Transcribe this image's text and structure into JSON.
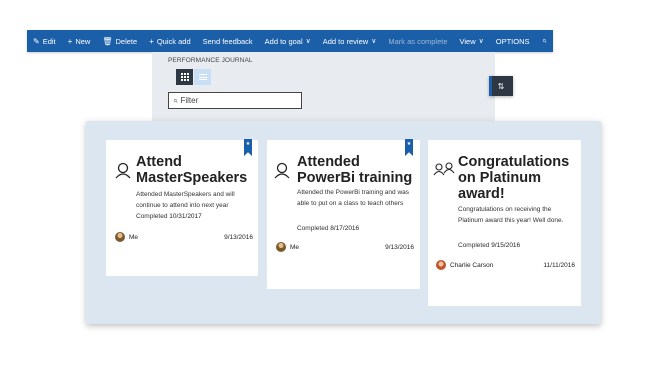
{
  "command_bar": {
    "edit": "Edit",
    "new": "New",
    "delete": "Delete",
    "quick_add": "Quick add",
    "send_feedback": "Send feedback",
    "add_to_goal": "Add to goal",
    "add_to_review": "Add to review",
    "mark_as_complete": "Mark as complete",
    "view": "View",
    "options": "OPTIONS"
  },
  "breadcrumb": "PERFORMANCE JOURNAL",
  "filter": {
    "placeholder": "Filter"
  },
  "cards": [
    {
      "title": "Attend MasterSpeakers",
      "description": "Attended MasterSpeakers and will continue to attend into next year",
      "completed_label": "Completed",
      "completed_date": "10/31/2017",
      "owner": "Me",
      "date": "9/13/2016",
      "bookmarked": true
    },
    {
      "title": "Attended PowerBi training",
      "description": "Attended the PowerBi training and was able to put on a class to teach others",
      "completed_label": "Completed",
      "completed_date": "8/17/2016",
      "owner": "Me",
      "date": "9/13/2016",
      "bookmarked": true
    },
    {
      "title": "Congratulations on Platinum award!",
      "description": "Congratulations on receiving the Platinum award this year! Well done.",
      "completed_label": "Completed",
      "completed_date": "9/15/2016",
      "owner": "Charlie Carson",
      "date": "11/11/2016",
      "bookmarked": false
    }
  ],
  "icons": {
    "edit": "pencil-icon",
    "new": "plus-icon",
    "delete": "trash-icon",
    "quick_add": "plus-icon",
    "search": "search-icon",
    "filter": "search-icon",
    "side_panel": "swap-icon",
    "card_person": "person-icon",
    "card_people": "people-icon",
    "bookmark": "bookmark-icon"
  },
  "colors": {
    "accent": "#1b5fa8",
    "dark": "#2d3844",
    "area_bg": "#dce6f0"
  }
}
